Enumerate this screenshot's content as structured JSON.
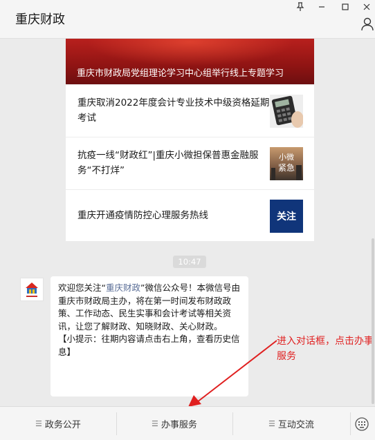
{
  "window": {
    "title": "重庆财政",
    "controls": [
      "pin-icon",
      "minimize-icon",
      "maximize-icon",
      "close-icon"
    ]
  },
  "articles": {
    "cover_title": "重庆市财政局党组理论学习中心组举行线上专题学习",
    "items": [
      {
        "title": "重庆取消2022年度会计专业技术中级资格延期考试",
        "thumb": "calculator-thumbnail"
      },
      {
        "title": "抗疫一线“财政红”|重庆小微担保普惠金融服务“不打烊”",
        "thumb": "news-thumbnail",
        "thumb_text": "小微\n紧急"
      },
      {
        "title": "重庆开通疫情防控心理服务热线",
        "thumb": "attention-thumbnail",
        "thumb_text": "关注"
      }
    ]
  },
  "time_label": "10:47",
  "welcome": {
    "part1": "欢迎您关注“",
    "link": "重庆财政",
    "part2": "”微信公众号！本微信号由重庆市财政局主办，将在第一时间发布财政政策、工作动态、民生实事和会计考试等相关资讯，让您了解财政、知晓财政、关心财政。",
    "tip": "【小提示：往期内容请点击右上角，查看历史信息】"
  },
  "annotation": {
    "text": "进入对话框，点击办事服务",
    "color": "#e02020"
  },
  "menu": {
    "items": [
      {
        "label": "政务公开"
      },
      {
        "label": "办事服务"
      },
      {
        "label": "互动交流"
      }
    ]
  },
  "colors": {
    "background": "#ebebeb",
    "link": "#576b95",
    "annotation": "#e02020",
    "cover": "#a31a18"
  }
}
